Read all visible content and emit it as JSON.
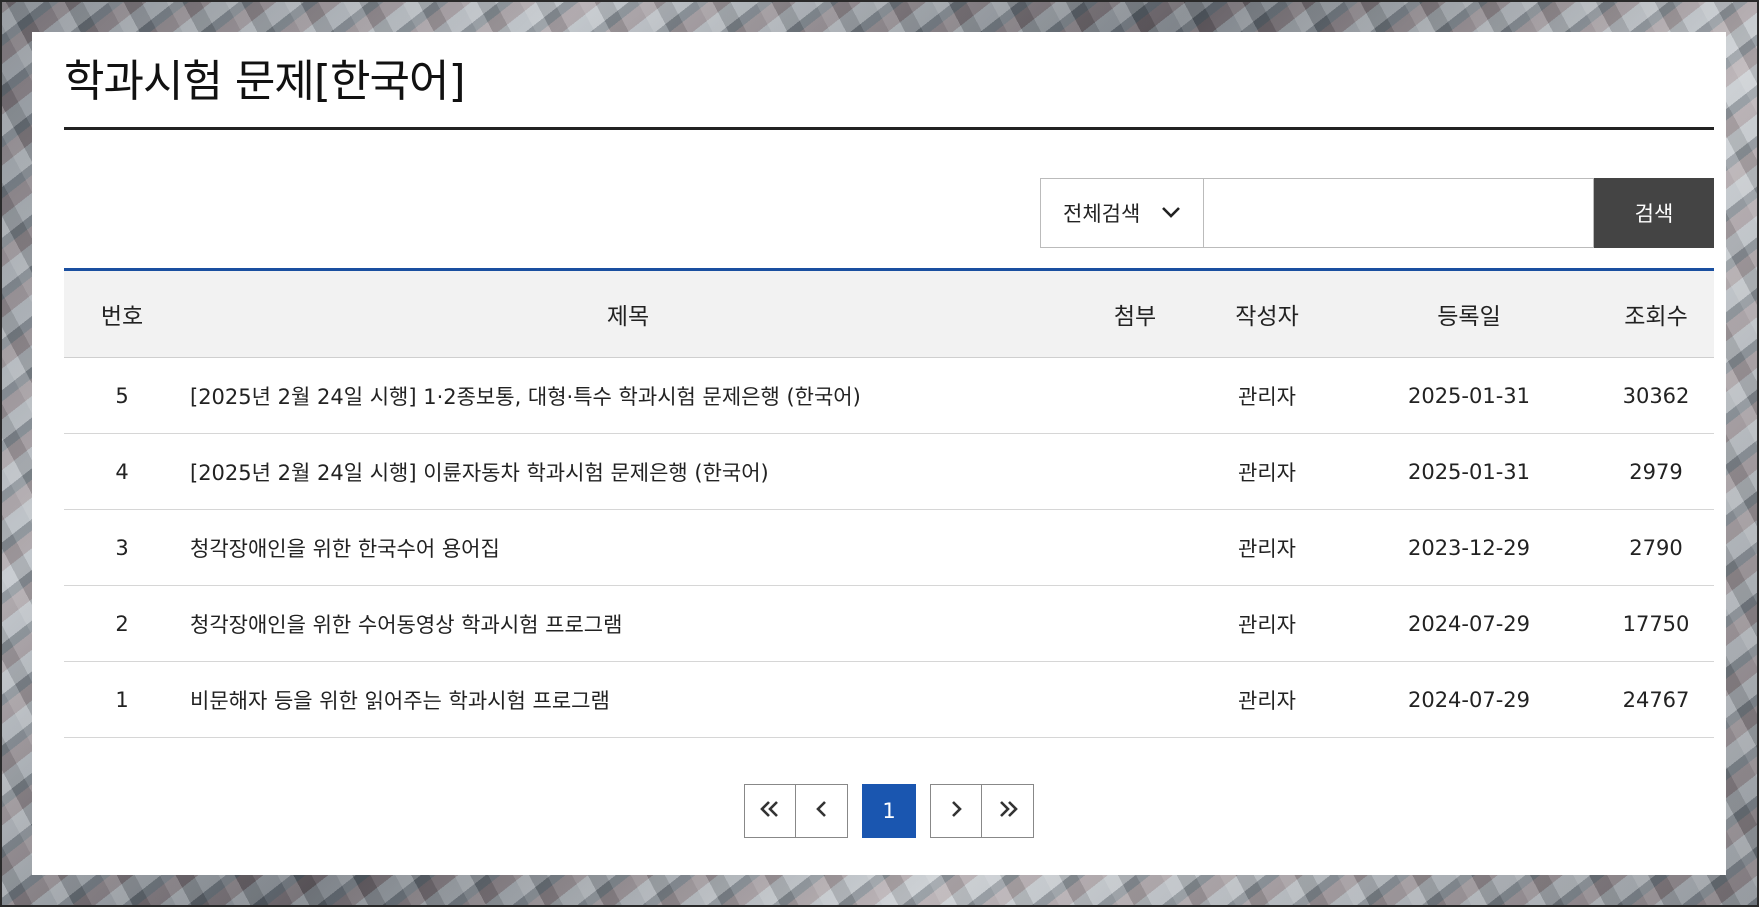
{
  "page": {
    "title": "학과시험 문제[한국어]"
  },
  "search": {
    "select_value": "전체검색",
    "input_value": "",
    "button_label": "검색"
  },
  "table": {
    "headers": {
      "number": "번호",
      "title": "제목",
      "attachment": "첨부",
      "writer": "작성자",
      "date": "등록일",
      "views": "조회수"
    },
    "rows": [
      {
        "number": "5",
        "title": "[2025년 2월 24일 시행] 1·2종보통, 대형·특수 학과시험 문제은행 (한국어)",
        "attachment": "",
        "writer": "관리자",
        "date": "2025-01-31",
        "views": "30362"
      },
      {
        "number": "4",
        "title": "[2025년 2월 24일 시행] 이륜자동차 학과시험 문제은행 (한국어)",
        "attachment": "",
        "writer": "관리자",
        "date": "2025-01-31",
        "views": "2979"
      },
      {
        "number": "3",
        "title": "청각장애인을 위한 한국수어 용어집",
        "attachment": "",
        "writer": "관리자",
        "date": "2023-12-29",
        "views": "2790"
      },
      {
        "number": "2",
        "title": "청각장애인을 위한 수어동영상 학과시험 프로그램",
        "attachment": "",
        "writer": "관리자",
        "date": "2024-07-29",
        "views": "17750"
      },
      {
        "number": "1",
        "title": "비문해자 등을 위한 읽어주는 학과시험 프로그램",
        "attachment": "",
        "writer": "관리자",
        "date": "2024-07-29",
        "views": "24767"
      }
    ]
  },
  "pagination": {
    "first_icon": "double-chevron-left-icon",
    "prev_icon": "chevron-left-icon",
    "current_page": "1",
    "next_icon": "chevron-right-icon",
    "last_icon": "double-chevron-right-icon"
  },
  "colors": {
    "accent": "#1a56b0",
    "search_button": "#444444",
    "header_bg": "#f2f2f2"
  }
}
